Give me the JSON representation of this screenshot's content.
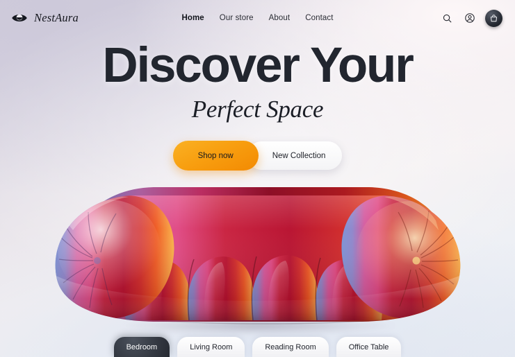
{
  "brand": {
    "name": "NestAura",
    "logo_icon": "lens-eye-logo-icon"
  },
  "nav": {
    "items": [
      {
        "label": "Home",
        "active": true
      },
      {
        "label": "Our store",
        "active": false
      },
      {
        "label": "About",
        "active": false
      },
      {
        "label": "Contact",
        "active": false
      }
    ]
  },
  "actions": {
    "search_icon": "search-icon",
    "account_icon": "user-account-icon",
    "cart_icon": "shopping-bag-icon"
  },
  "hero": {
    "headline": "Discover Your",
    "subhead": "Perfect Space",
    "primary_cta": "Shop now",
    "secondary_cta": "New Collection"
  },
  "product": {
    "alt": "Puffy glossy modular sofa with blue to pink to red to orange gradient finish",
    "colors": {
      "left": "#6f8fd0",
      "mid_left": "#e0559b",
      "mid": "#c32140",
      "right": "#e8412a",
      "far_right": "#f8a93c"
    }
  },
  "categories": {
    "items": [
      {
        "label": "Bedroom",
        "active": true
      },
      {
        "label": "Living Room",
        "active": false
      },
      {
        "label": "Reading Room",
        "active": false
      },
      {
        "label": "Office Table",
        "active": false
      }
    ]
  },
  "theme": {
    "accent": "#f89f10",
    "text_dark": "#22262f",
    "chip_active_bg": "#343942"
  }
}
